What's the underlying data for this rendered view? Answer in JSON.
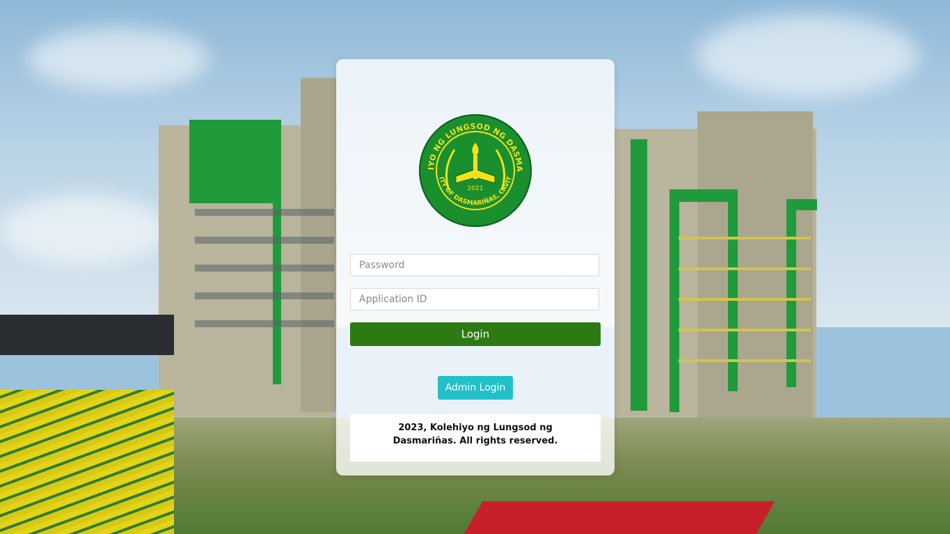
{
  "logo": {
    "top_text": "KOLEHIYO NG LUNGSOD NG DASMARIÑAS",
    "bottom_text": "CITY OF DASMARIÑAS, CAVITE",
    "year": "2021",
    "ring_color": "#1a8f2e",
    "inner_color": "#f2e21c"
  },
  "form": {
    "password_placeholder": "Password",
    "application_id_placeholder": "Application ID",
    "login_label": "Login",
    "admin_login_label": "Admin Login"
  },
  "footer": {
    "text": "2023, Kolehiyo ng Lungsod ng Dasmariñas. All rights reserved."
  },
  "colors": {
    "login_button": "#2e7a12",
    "admin_button": "#21c0cb"
  }
}
